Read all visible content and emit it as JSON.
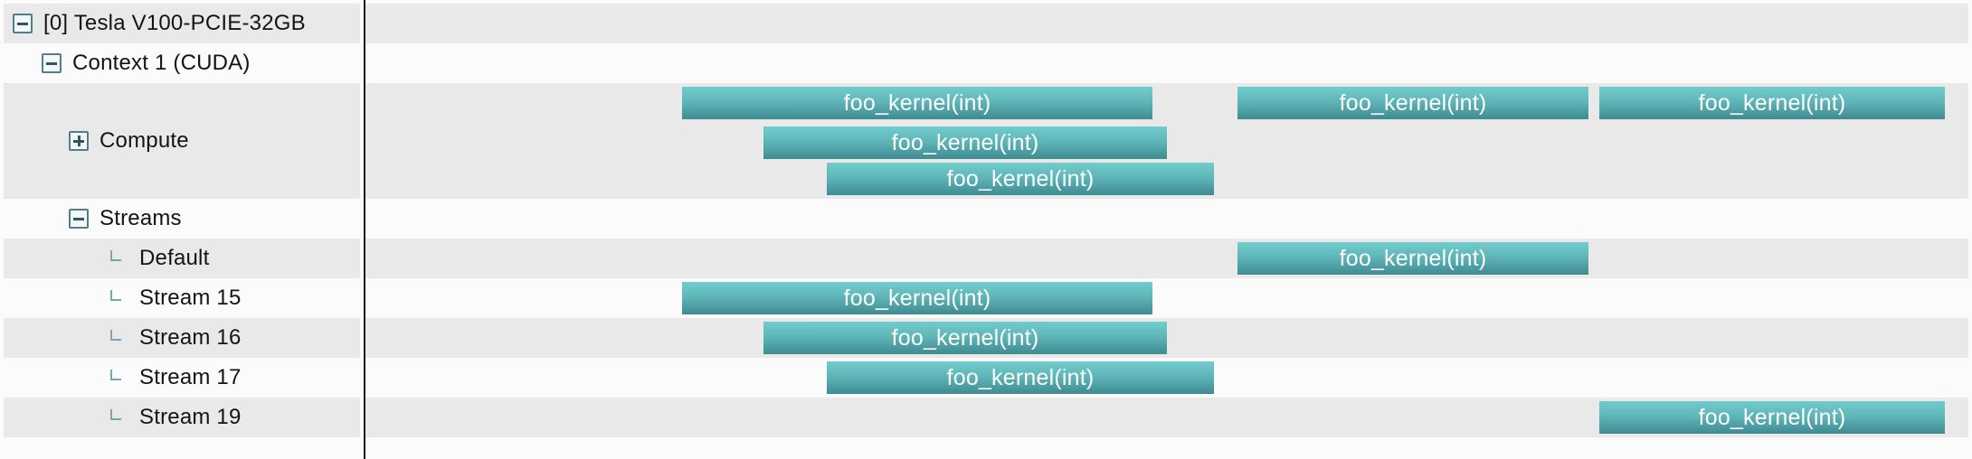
{
  "tree": {
    "device": "[0] Tesla V100-PCIE-32GB",
    "context": "Context 1 (CUDA)",
    "compute": "Compute",
    "streams": "Streams",
    "stream_items": [
      "Default",
      "Stream 15",
      "Stream 16",
      "Stream 17",
      "Stream 19"
    ]
  },
  "kernels": {
    "compute_1": "foo_kernel(int)",
    "compute_2": "foo_kernel(int)",
    "compute_3": "foo_kernel(int)",
    "compute_4": "foo_kernel(int)",
    "compute_5": "foo_kernel(int)",
    "default": "foo_kernel(int)",
    "stream_15": "foo_kernel(int)",
    "stream_16": "foo_kernel(int)",
    "stream_17": "foo_kernel(int)",
    "stream_19": "foo_kernel(int)"
  },
  "colors": {
    "kernel_top": "#72cccc",
    "kernel_bottom": "#3f8b91",
    "row_shade": "#e9e9e9",
    "divider": "#1a1a1a"
  }
}
